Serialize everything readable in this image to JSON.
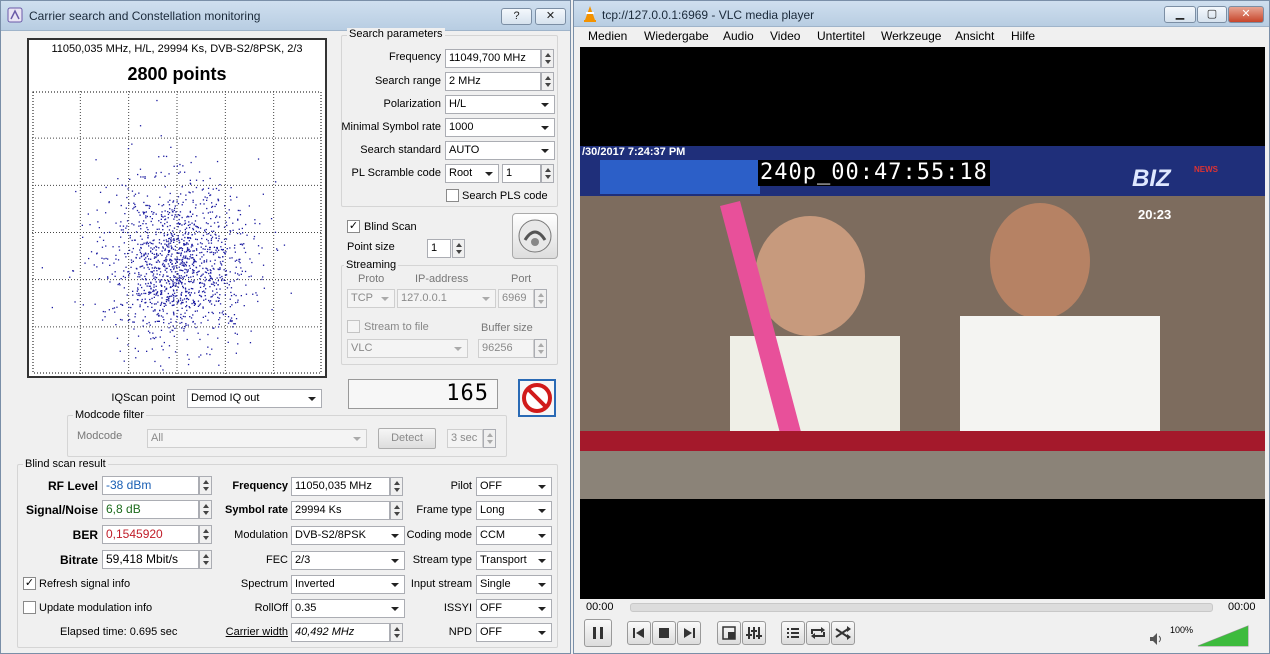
{
  "left_window": {
    "title": "Carrier search and Constellation monitoring",
    "help_btn": "?",
    "close_btn": "✕",
    "constellation": {
      "header": "11050,035 MHz, H/L, 29994 Ks, DVB-S2/8PSK, 2/3",
      "points_label": "2800 points",
      "point_count": 2800
    },
    "search_params": {
      "title": "Search parameters",
      "frequency_label": "Frequency",
      "frequency_value": "11049,700 MHz",
      "search_range_label": "Search range",
      "search_range_value": "2 MHz",
      "polarization_label": "Polarization",
      "polarization_value": "H/L",
      "min_symbol_rate_label": "Minimal Symbol rate",
      "min_symbol_rate_value": "1000",
      "search_standard_label": "Search standard",
      "search_standard_value": "AUTO",
      "pl_scramble_label": "PL Scramble code",
      "pl_scramble_mode": "Root",
      "pl_scramble_value": "1",
      "search_pls_label": "Search PLS code"
    },
    "blind_scan_label": "Blind Scan",
    "point_size_label": "Point size",
    "point_size_value": "1",
    "streaming": {
      "title": "Streaming",
      "proto_label": "Proto",
      "ip_label": "IP-address",
      "port_label": "Port",
      "proto_value": "TCP",
      "ip_value": "127.0.0.1",
      "port_value": "6969",
      "stream_to_file_label": "Stream to file",
      "buffer_size_label": "Buffer size",
      "player_value": "VLC",
      "buffer_value": "96256"
    },
    "iqscan_label": "IQScan point",
    "iqscan_value": "Demod IQ out",
    "counter_value": "165",
    "modcode_filter": {
      "title": "Modcode filter",
      "modcode_label": "Modcode",
      "modcode_value": "All",
      "detect_button": "Detect",
      "timeout_value": "3 sec"
    },
    "result": {
      "title": "Blind scan result",
      "rf_level_label": "RF Level",
      "rf_level_value": "-38 dBm",
      "snr_label": "Signal/Noise",
      "snr_value": "6,8 dB",
      "ber_label": "BER",
      "ber_value": "0,1545920",
      "bitrate_label": "Bitrate",
      "bitrate_value": "59,418 Mbit/s",
      "frequency_label": "Frequency",
      "frequency_value": "11050,035 MHz",
      "symbol_rate_label": "Symbol rate",
      "symbol_rate_value": "29994 Ks",
      "modulation_label": "Modulation",
      "modulation_value": "DVB-S2/8PSK",
      "fec_label": "FEC",
      "fec_value": "2/3",
      "spectrum_label": "Spectrum",
      "spectrum_value": "Inverted",
      "rolloff_label": "RollOff",
      "rolloff_value": "0.35",
      "carrier_width_label": "Carrier width",
      "carrier_width_value": "40,492 MHz",
      "pilot_label": "Pilot",
      "pilot_value": "OFF",
      "frame_type_label": "Frame type",
      "frame_type_value": "Long",
      "coding_mode_label": "Coding mode",
      "coding_mode_value": "CCM",
      "stream_type_label": "Stream type",
      "stream_type_value": "Transport",
      "input_stream_label": "Input stream",
      "input_stream_value": "Single",
      "issyi_label": "ISSYI",
      "issyi_value": "OFF",
      "npd_label": "NPD",
      "npd_value": "OFF",
      "refresh_label": "Refresh signal info",
      "update_mod_label": "Update modulation info",
      "elapsed_label": "Elapsed time: 0.695 sec"
    },
    "colors": {
      "rf": "#1a5fb4",
      "snr": "#1c6b1c",
      "ber": "#c01c28",
      "dots": "#1a1aa0"
    }
  },
  "vlc": {
    "title": "tcp://127.0.0.1:6969 - VLC media player",
    "menu": [
      "Medien",
      "Wiedergabe",
      "Audio",
      "Video",
      "Untertitel",
      "Werkzeuge",
      "Ansicht",
      "Hilfe"
    ],
    "video": {
      "date_overlay": "/30/2017 7:24:37 PM",
      "timecode": "240p_00:47:55:18",
      "channel_logo": "BIZ",
      "channel_sub": "NEWS",
      "clock": "20:23"
    },
    "time_elapsed": "00:00",
    "time_total": "00:00",
    "volume": "100%",
    "volume_level": 1.0
  }
}
